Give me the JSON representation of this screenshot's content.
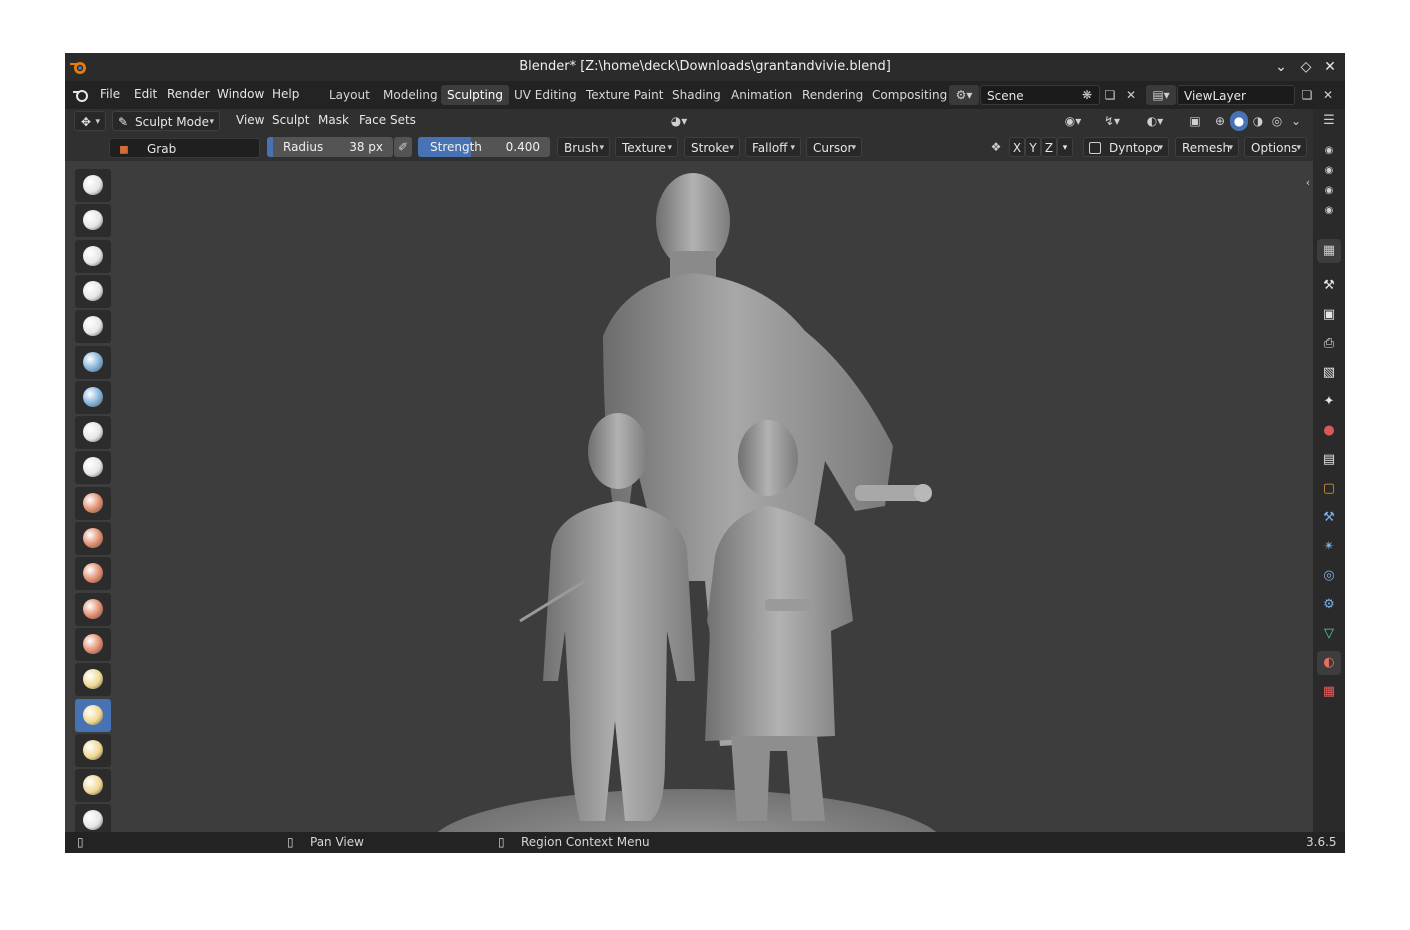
{
  "window": {
    "title": "Blender* [Z:\\home\\deck\\Downloads\\grantandvivie.blend]",
    "controls": [
      "chevron-down-icon",
      "restore-icon",
      "close-icon"
    ]
  },
  "menu": {
    "items": [
      "File",
      "Edit",
      "Render",
      "Window",
      "Help"
    ]
  },
  "workspaces": {
    "tabs": [
      "Layout",
      "Modeling",
      "Sculpting",
      "UV Editing",
      "Texture Paint",
      "Shading",
      "Animation",
      "Rendering",
      "Compositing"
    ],
    "active": "Sculpting"
  },
  "scene": {
    "name": "Scene"
  },
  "view_layer": {
    "name": "ViewLayer"
  },
  "header": {
    "mode": "Sculpt Mode",
    "menus": [
      "View",
      "Sculpt",
      "Mask",
      "Face Sets"
    ]
  },
  "tool_settings": {
    "brush_name": "Grab",
    "radius_label": "Radius",
    "radius_value": "38 px",
    "strength_label": "Strength",
    "strength_value": "0.400",
    "strength_fraction": 0.4,
    "dropdowns": [
      "Brush",
      "Texture",
      "Stroke",
      "Falloff",
      "Cursor"
    ],
    "symmetry_axes": [
      "X",
      "Y",
      "Z"
    ],
    "dyntopo_label": "Dyntopo",
    "remesh_label": "Remesh",
    "options_label": "Options"
  },
  "toolbar": {
    "tools": [
      "draw-brush-icon",
      "draw-sharp-brush-icon",
      "clay-brush-icon",
      "clay-strips-brush-icon",
      "clay-thumb-brush-icon",
      "layer-brush-icon",
      "inflate-brush-icon",
      "blob-brush-icon",
      "crease-brush-icon",
      "smooth-brush-icon",
      "flatten-brush-icon",
      "fill-brush-icon",
      "scrape-brush-icon",
      "multiplane-scrape-brush-icon",
      "pinch-brush-icon",
      "grab-brush-icon",
      "elastic-deform-brush-icon",
      "snake-hook-brush-icon",
      "thumb-brush-icon"
    ],
    "active_index": 15,
    "colors": [
      "#e6e6e6",
      "#e6e6e6",
      "#e6e6e6",
      "#e6e6e6",
      "#e6e6e6",
      "#7fb0d8",
      "#7fb0d8",
      "#e6e6e6",
      "#e6e6e6",
      "#e08a6a",
      "#e08a6a",
      "#e08a6a",
      "#e08a6a",
      "#e08a6a",
      "#f0d890",
      "#f0d890",
      "#f0d890",
      "#f0d890",
      "#e6e6e6"
    ]
  },
  "properties": {
    "tabs": [
      "tool-icon",
      "render-icon",
      "output-icon",
      "view-layer-icon",
      "scene-icon",
      "world-icon",
      "collection-icon",
      "object-icon",
      "modifier-icon",
      "particles-icon",
      "physics-icon",
      "constraints-icon",
      "data-icon",
      "material-icon",
      "texture-icon"
    ]
  },
  "status": {
    "left_hint": "Pan View",
    "right_hint": "Region Context Menu",
    "version": "3.6.5"
  },
  "accent_color": "#4772b3"
}
